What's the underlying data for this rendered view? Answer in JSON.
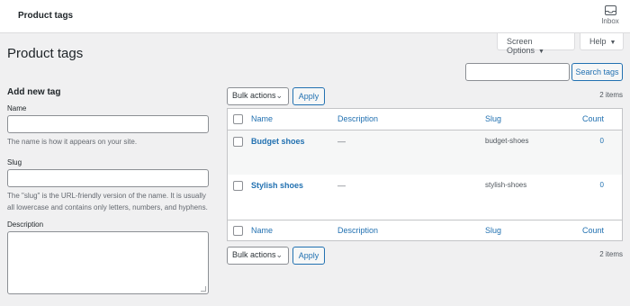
{
  "topbar": {
    "title": "Product tags",
    "inbox_label": "Inbox"
  },
  "tabs": {
    "screen_options": "Screen Options",
    "help": "Help"
  },
  "page_title": "Product tags",
  "search": {
    "button": "Search tags",
    "placeholder": ""
  },
  "add_form": {
    "heading": "Add new tag",
    "name_label": "Name",
    "name_help": "The name is how it appears on your site.",
    "slug_label": "Slug",
    "slug_help": "The \"slug\" is the URL-friendly version of the name. It is usually all lowercase and contains only letters, numbers, and hyphens.",
    "description_label": "Description"
  },
  "bulk": {
    "label": "Bulk actions",
    "apply": "Apply",
    "items_count": "2 items"
  },
  "table": {
    "columns": {
      "name": "Name",
      "description": "Description",
      "slug": "Slug",
      "count": "Count"
    },
    "rows": [
      {
        "name": "Budget shoes",
        "description": "—",
        "slug": "budget-shoes",
        "count": "0"
      },
      {
        "name": "Stylish shoes",
        "description": "—",
        "slug": "stylish-shoes",
        "count": "0"
      }
    ]
  },
  "colors": {
    "link": "#2271b1",
    "background": "#f0f0f1",
    "text": "#1d2327"
  },
  "icons": {
    "inbox": "inbox-icon",
    "dropdown": "triangle-down-icon",
    "select": "chevron-down-icon"
  }
}
